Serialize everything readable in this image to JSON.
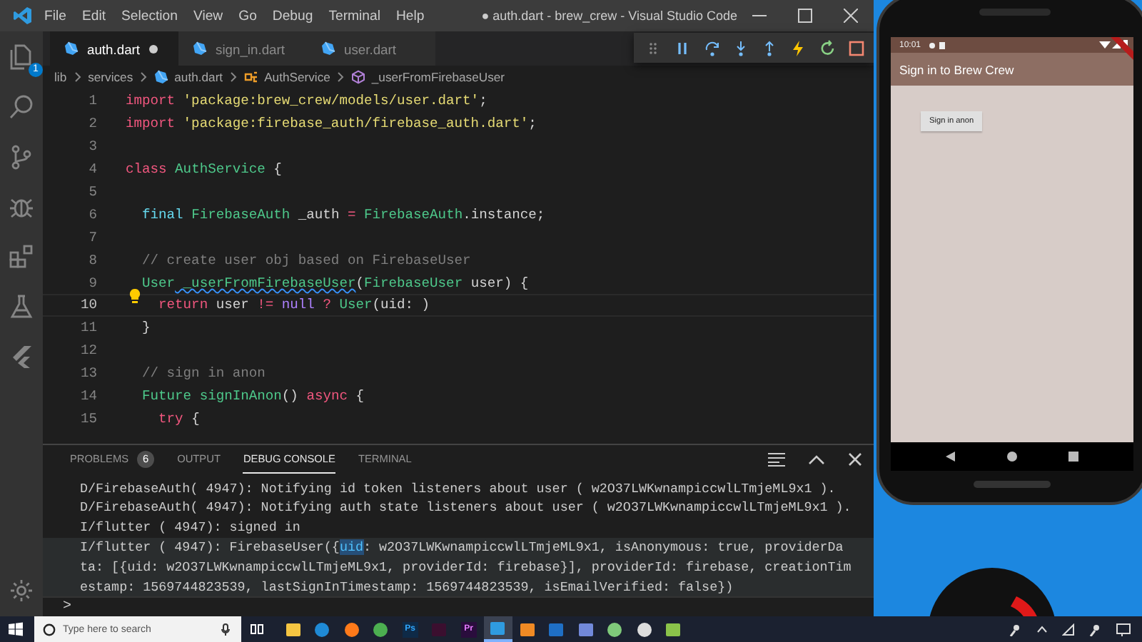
{
  "window": {
    "title": "● auth.dart - brew_crew - Visual Studio Code"
  },
  "menu": [
    "File",
    "Edit",
    "Selection",
    "View",
    "Go",
    "Debug",
    "Terminal",
    "Help"
  ],
  "activity_bar": {
    "explorer_badge": "1"
  },
  "tabs": [
    {
      "label": "auth.dart",
      "selected": true,
      "dirty": true
    },
    {
      "label": "sign_in.dart",
      "selected": false,
      "dirty": false
    },
    {
      "label": "user.dart",
      "selected": false,
      "dirty": false
    }
  ],
  "breadcrumbs": [
    {
      "label": "lib",
      "kind": "folder"
    },
    {
      "label": "services",
      "kind": "folder"
    },
    {
      "label": "auth.dart",
      "kind": "file"
    },
    {
      "label": "AuthService",
      "kind": "class"
    },
    {
      "label": "_userFromFirebaseUser",
      "kind": "method"
    }
  ],
  "editor": {
    "lines": [
      {
        "number": "1",
        "current": false,
        "lightbulb": false,
        "tokens": [
          {
            "text": "import",
            "kind": "keyword"
          },
          {
            "text": " 'package:brew_crew/models/user.dart'",
            "kind": "string"
          },
          {
            "text": ";",
            "kind": "plain"
          }
        ]
      },
      {
        "number": "2",
        "current": false,
        "lightbulb": false,
        "tokens": [
          {
            "text": "import",
            "kind": "keyword"
          },
          {
            "text": " 'package:firebase_auth/firebase_auth.dart'",
            "kind": "string"
          },
          {
            "text": ";",
            "kind": "plain"
          }
        ]
      },
      {
        "number": "3",
        "current": false,
        "lightbulb": false
      },
      {
        "number": "4",
        "current": false,
        "lightbulb": false,
        "tokens": [
          {
            "text": "class",
            "kind": "keyword"
          },
          {
            "text": " AuthService",
            "kind": "type"
          },
          {
            "text": " {",
            "kind": "plain"
          }
        ]
      },
      {
        "number": "5",
        "current": false,
        "lightbulb": false
      },
      {
        "number": "6",
        "current": false,
        "lightbulb": false,
        "tokens": [
          {
            "text": "  final",
            "kind": "storage"
          },
          {
            "text": " FirebaseAuth",
            "kind": "type"
          },
          {
            "text": " _auth ",
            "kind": "plain"
          },
          {
            "text": "=",
            "kind": "op"
          },
          {
            "text": " FirebaseAuth",
            "kind": "type"
          },
          {
            "text": ".instance;",
            "kind": "plain"
          }
        ]
      },
      {
        "number": "7",
        "current": false,
        "lightbulb": false
      },
      {
        "number": "8",
        "current": false,
        "lightbulb": false,
        "tokens": [
          {
            "text": "  // create user obj based on FirebaseUser",
            "kind": "comment"
          }
        ]
      },
      {
        "number": "9",
        "current": false,
        "lightbulb": false,
        "tokens": [
          {
            "text": "  User",
            "kind": "type"
          },
          {
            "text": " _userFromFirebaseUser",
            "kind": "function",
            "squiggly": true
          },
          {
            "text": "(",
            "kind": "plain"
          },
          {
            "text": "FirebaseUser",
            "kind": "type"
          },
          {
            "text": " user) {",
            "kind": "plain"
          }
        ]
      },
      {
        "number": "10",
        "current": true,
        "lightbulb": true,
        "tokens": [
          {
            "text": "    return",
            "kind": "keyword"
          },
          {
            "text": " user ",
            "kind": "plain"
          },
          {
            "text": "!=",
            "kind": "op"
          },
          {
            "text": " null",
            "kind": "constant"
          },
          {
            "text": " ?",
            "kind": "op"
          },
          {
            "text": " User",
            "kind": "type"
          },
          {
            "text": "(uid: )",
            "kind": "plain"
          }
        ]
      },
      {
        "number": "11",
        "current": false,
        "lightbulb": false,
        "tokens": [
          {
            "text": "  }",
            "kind": "plain"
          }
        ]
      },
      {
        "number": "12",
        "current": false,
        "lightbulb": false
      },
      {
        "number": "13",
        "current": false,
        "lightbulb": false,
        "tokens": [
          {
            "text": "  // sign in anon",
            "kind": "comment"
          }
        ]
      },
      {
        "number": "14",
        "current": false,
        "lightbulb": false,
        "tokens": [
          {
            "text": "  Future",
            "kind": "type"
          },
          {
            "text": " signInAnon",
            "kind": "function"
          },
          {
            "text": "() ",
            "kind": "plain"
          },
          {
            "text": "async",
            "kind": "keyword"
          },
          {
            "text": " {",
            "kind": "plain"
          }
        ]
      },
      {
        "number": "15",
        "current": false,
        "lightbulb": false,
        "tokens": [
          {
            "text": "    try",
            "kind": "keyword"
          },
          {
            "text": " {",
            "kind": "plain"
          }
        ]
      }
    ]
  },
  "panel": {
    "tabs": [
      {
        "label": "PROBLEMS",
        "selected": false,
        "badge": "6"
      },
      {
        "label": "OUTPUT",
        "selected": false
      },
      {
        "label": "DEBUG CONSOLE",
        "selected": true
      },
      {
        "label": "TERMINAL",
        "selected": false
      }
    ],
    "console": [
      {
        "hovered": false,
        "segments": [
          {
            "text": "D/FirebaseAuth( 4947): Notifying id token listeners about user ( w2O37LWKwnampiccwlLTmjeML9x1 ).",
            "selected": false
          }
        ]
      },
      {
        "hovered": false,
        "segments": [
          {
            "text": "D/FirebaseAuth( 4947): Notifying auth state listeners about user ( w2O37LWKwnampiccwlLTmjeML9x1 ).",
            "selected": false
          }
        ]
      },
      {
        "hovered": false,
        "segments": [
          {
            "text": "I/flutter ( 4947): signed in",
            "selected": false
          }
        ]
      },
      {
        "hovered": true,
        "segments": [
          {
            "text": "I/flutter ( 4947): FirebaseUser({",
            "selected": false
          },
          {
            "text": "uid",
            "selected": true
          },
          {
            "text": ": w2O37LWKwnampiccwlLTmjeML9x1, isAnonymous: true, providerData: [{uid: w2O37LWKwnampiccwlLTmjeML9x1, providerId: firebase}], providerId: firebase, creationTimestamp: 1569744823539, lastSignInTimestamp: 1569744823539, isEmailVerified: false})",
            "selected": false
          }
        ]
      }
    ],
    "prompt": ">"
  },
  "phone": {
    "time": "10:01",
    "app_title": "Sign in to Brew Crew",
    "button": "Sign in anon"
  },
  "taskbar": {
    "search_placeholder": "Type here to search",
    "apps": [
      {
        "kind": "explorer",
        "selected": false
      },
      {
        "kind": "edge",
        "selected": false
      },
      {
        "kind": "firefox",
        "selected": false
      },
      {
        "kind": "chrome",
        "selected": false
      },
      {
        "kind": "photoshop",
        "label": "Ps",
        "selected": false
      },
      {
        "kind": "magenta",
        "selected": false
      },
      {
        "kind": "premiere",
        "label": "Pr",
        "selected": false
      },
      {
        "kind": "vscode",
        "selected": true
      },
      {
        "kind": "sublime",
        "selected": false
      },
      {
        "kind": "outlook",
        "selected": false
      },
      {
        "kind": "discord",
        "selected": false
      },
      {
        "kind": "android",
        "selected": false
      },
      {
        "kind": "unity",
        "selected": false
      },
      {
        "kind": "green",
        "selected": false
      }
    ]
  }
}
